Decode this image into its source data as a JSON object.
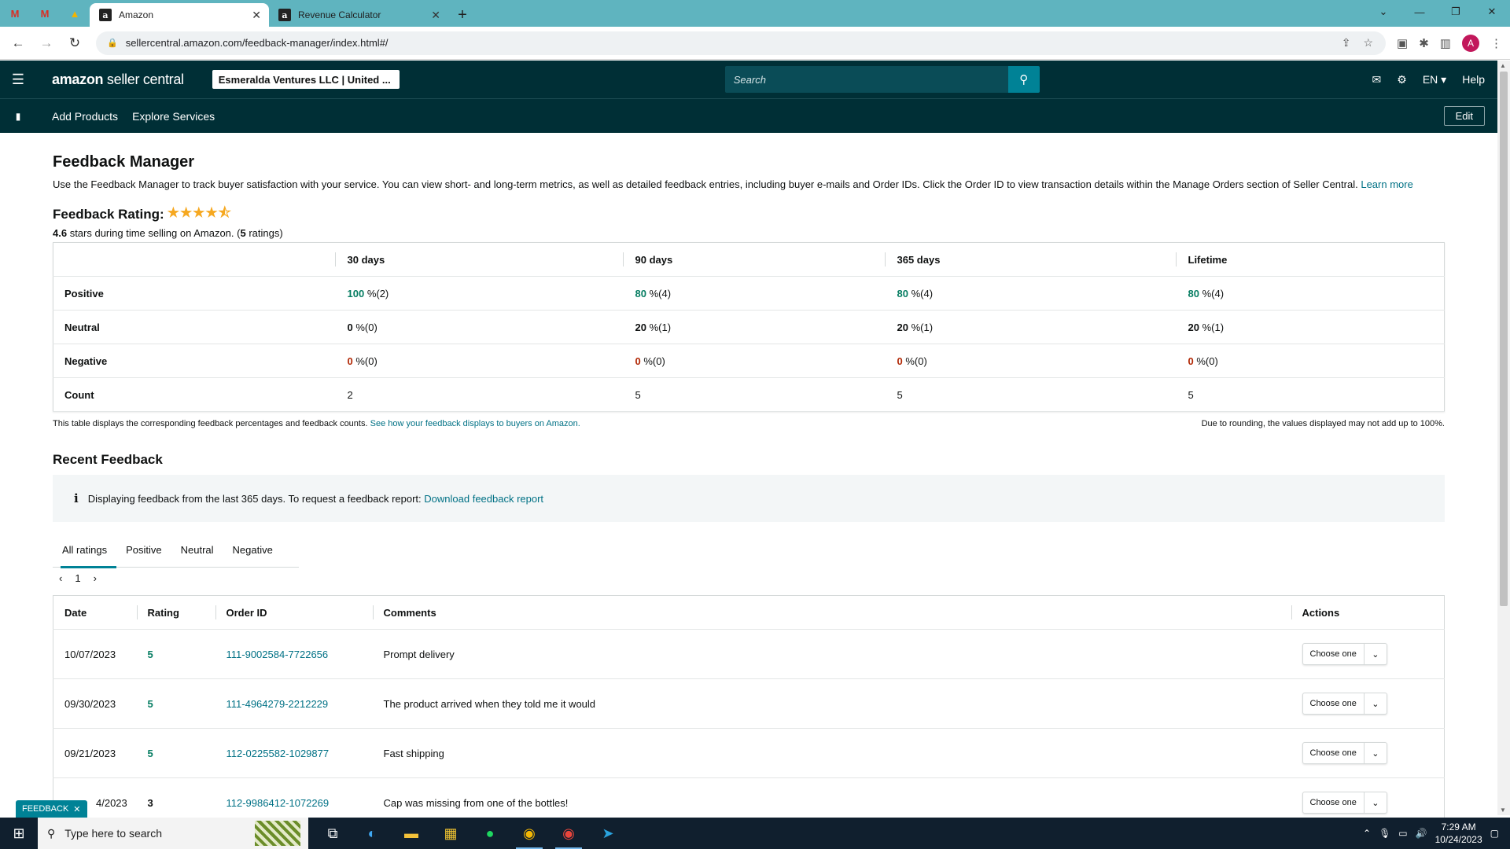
{
  "browser": {
    "tabs": [
      {
        "title": "Amazon",
        "favicon": "a",
        "active": true
      },
      {
        "title": "Revenue Calculator",
        "favicon": "a",
        "active": false
      }
    ],
    "url": "sellercentral.amazon.com/feedback-manager/index.html#/"
  },
  "header": {
    "logo_main": "amazon",
    "logo_sub": " seller central",
    "account": "Esmeralda Ventures LLC | United ...",
    "search_placeholder": "Search",
    "lang": "EN ▾",
    "help": "Help"
  },
  "subnav": {
    "items": [
      "Add Products",
      "Explore Services"
    ],
    "edit": "Edit"
  },
  "page": {
    "title": "Feedback Manager",
    "description": "Use the Feedback Manager to track buyer satisfaction with your service. You can view short- and long-term metrics, as well as detailed feedback entries, including buyer e-mails and Order IDs. Click the Order ID to view transaction details within the Manage Orders section of Seller Central.",
    "learn_more": "Learn more",
    "rating_label": "Feedback Rating:",
    "rating_value": "4.6",
    "rating_text": " stars during time selling on Amazon. (",
    "rating_count": "5",
    "rating_text_end": " ratings)"
  },
  "metrics": {
    "columns": [
      "30 days",
      "90 days",
      "365 days",
      "Lifetime"
    ],
    "rows": [
      {
        "label": "Positive",
        "cells": [
          [
            "100",
            " %(2)"
          ],
          [
            "80",
            " %(4)"
          ],
          [
            "80",
            " %(4)"
          ],
          [
            "80",
            " %(4)"
          ]
        ]
      },
      {
        "label": "Neutral",
        "cells": [
          [
            "0",
            " %(0)"
          ],
          [
            "20",
            " %(1)"
          ],
          [
            "20",
            " %(1)"
          ],
          [
            "20",
            " %(1)"
          ]
        ]
      },
      {
        "label": "Negative",
        "cells": [
          [
            "0",
            " %(0)"
          ],
          [
            "0",
            " %(0)"
          ],
          [
            "0",
            " %(0)"
          ],
          [
            "0",
            " %(0)"
          ]
        ]
      },
      {
        "label": "Count",
        "cells": [
          [
            "2",
            ""
          ],
          [
            "5",
            ""
          ],
          [
            "5",
            ""
          ],
          [
            "5",
            ""
          ]
        ]
      }
    ],
    "note_left": "This table displays the corresponding feedback percentages and feedback counts.",
    "note_link": "See how your feedback displays to buyers on Amazon.",
    "note_right": "Due to rounding, the values displayed may not add up to 100%."
  },
  "recent": {
    "title": "Recent Feedback",
    "info": "Displaying feedback from the last 365 days. To request a feedback report:",
    "info_link": "Download feedback report",
    "tabs": [
      "All ratings",
      "Positive",
      "Neutral",
      "Negative"
    ],
    "page": "1",
    "columns": [
      "Date",
      "Rating",
      "Order ID",
      "Comments",
      "Actions"
    ],
    "rows": [
      {
        "date": "10/07/2023",
        "rating": "5",
        "order": "111-9002584-7722656",
        "comment": "Prompt delivery",
        "action": "Choose one"
      },
      {
        "date": "09/30/2023",
        "rating": "5",
        "order": "111-4964279-2212229",
        "comment": "The product arrived when they told me it would",
        "action": "Choose one"
      },
      {
        "date": "09/21/2023",
        "rating": "5",
        "order": "112-0225582-1029877",
        "comment": "Fast shipping",
        "action": "Choose one"
      },
      {
        "date": "4/2023",
        "rating": "3",
        "order": "112-9986412-1072269",
        "comment": "Cap was missing from one of the bottles!",
        "action": "Choose one"
      }
    ]
  },
  "feedback_tab": "FEEDBACK",
  "taskbar": {
    "search_placeholder": "Type here to search",
    "time": "7:29 AM",
    "date": "10/24/2023"
  },
  "colors": {
    "header_bg": "#002f36",
    "link": "#007185",
    "positive": "#067d62",
    "negative": "#b12704",
    "star": "#f6a820",
    "tabbar": "#5fb4bf"
  }
}
